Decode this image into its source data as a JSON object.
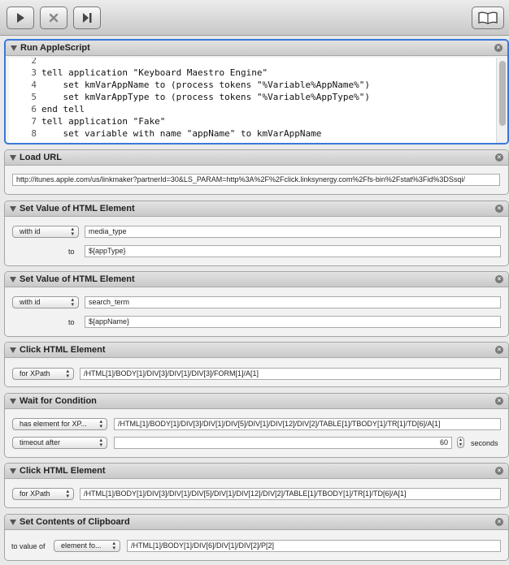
{
  "toolbar": {
    "buttons": [
      "play-icon",
      "stop-icon",
      "step-icon"
    ],
    "right_button": "book-icon"
  },
  "actions": [
    {
      "title": "Run AppleScript",
      "lines": [
        {
          "no": "2",
          "code": ""
        },
        {
          "no": "3",
          "code": "tell application \"Keyboard Maestro Engine\""
        },
        {
          "no": "4",
          "code": "    set kmVarAppName to (process tokens \"%Variable%AppName%\")"
        },
        {
          "no": "5",
          "code": "    set kmVarAppType to (process tokens \"%Variable%AppType%\")"
        },
        {
          "no": "6",
          "code": "end tell"
        },
        {
          "no": "7",
          "code": "tell application \"Fake\""
        },
        {
          "no": "8",
          "code": "    set variable with name \"appName\" to kmVarAppName"
        }
      ]
    },
    {
      "title": "Load URL",
      "url": "http://itunes.apple.com/us/linkmaker?partnerId=30&LS_PARAM=http%3A%2F%2Fclick.linksynergy.com%2Ffs-bin%2Fstat%3Fid%3DSsqi/"
    },
    {
      "title": "Set Value of HTML Element",
      "popup": "with id",
      "value": "media_type",
      "to_label": "to",
      "to_value": "${appType}"
    },
    {
      "title": "Set Value of HTML Element",
      "popup": "with id",
      "value": "search_term",
      "to_label": "to",
      "to_value": "${appName}"
    },
    {
      "title": "Click HTML Element",
      "popup": "for XPath",
      "value": "/HTML[1]/BODY[1]/DIV[3]/DIV[1]/DIV[3]/FORM[1]/A[1]"
    },
    {
      "title": "Wait for Condition",
      "popup": "has element for XP...",
      "value": "/HTML[1]/BODY[1]/DIV[3]/DIV[1]/DIV[5]/DIV[1]/DIV[12]/DIV[2]/TABLE[1]/TBODY[1]/TR[1]/TD[6]/A[1]",
      "timeout_popup": "timeout after",
      "timeout_value": "60",
      "timeout_unit": "seconds"
    },
    {
      "title": "Click HTML Element",
      "popup": "for XPath",
      "value": "/HTML[1]/BODY[1]/DIV[3]/DIV[1]/DIV[5]/DIV[1]/DIV[12]/DIV[2]/TABLE[1]/TBODY[1]/TR[1]/TD[6]/A[1]"
    },
    {
      "title": "Set Contents of Clipboard",
      "label": "to value of",
      "popup": "element fo...",
      "value": "/HTML[1]/BODY[1]/DIV[6]/DIV[1]/DIV[2]/P[2]"
    }
  ],
  "colors": {
    "selection": "#3a78d8"
  }
}
